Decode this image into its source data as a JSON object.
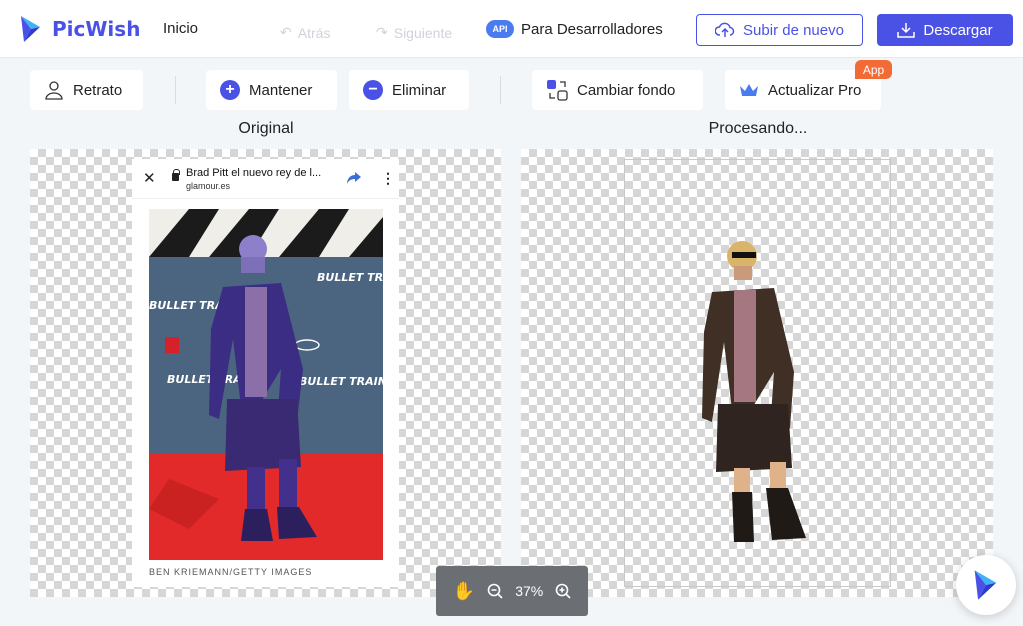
{
  "header": {
    "brand": "PicWish",
    "nav_home": "Inicio",
    "undo_label": "Atrás",
    "redo_label": "Siguiente",
    "api_badge": "API",
    "api_label": "Para Desarrolladores",
    "upload_label": "Subir de nuevo",
    "download_label": "Descargar"
  },
  "toolbar": {
    "portrait_label": "Retrato",
    "keep_label": "Mantener",
    "remove_label": "Eliminar",
    "change_bg_label": "Cambiar fondo",
    "upgrade_label": "Actualizar Pro",
    "app_badge": "App"
  },
  "panels": {
    "original_title": "Original",
    "processed_title": "Procesando..."
  },
  "source_card": {
    "page_title": "Brad Pitt el nuevo rey de l...",
    "domain": "glamour.es",
    "credit": "BEN KRIEMANN/GETTY IMAGES",
    "backdrop_text": "BULLET TRAIN"
  },
  "zoom": {
    "level": "37%"
  },
  "colors": {
    "accent": "#4a52e6",
    "app_badge": "#f26b36",
    "carpet": "#e32a2a"
  }
}
